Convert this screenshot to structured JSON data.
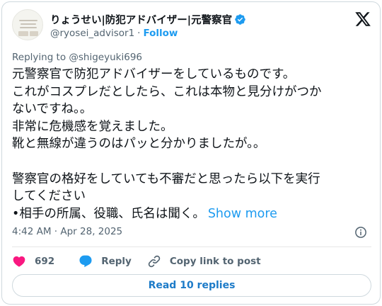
{
  "author": {
    "display_name": "りょうせい|防犯アドバイザー|元警察官",
    "handle": "@ryosei_advisor1",
    "separator": "·",
    "follow_label": "Follow"
  },
  "tweet": {
    "replying_to": "Replying to @shigeyuki696",
    "lines": [
      "元警察官で防犯アドバイザーをしているものです。",
      "これがコスプレだとしたら、これは本物と見分けがつか",
      "ないですね。。",
      "非常に危機感を覚えました。",
      "靴と無線が違うのはパッと分かりましたが。。",
      "",
      "警察官の格好をしていても不審だと思ったら以下を実行",
      "してください",
      "•相手の所属、役職、氏名は聞く。"
    ],
    "show_more_label": "Show more",
    "timestamp": "4:42 AM · Apr 28, 2025"
  },
  "actions": {
    "like_count": "692",
    "reply_label": "Reply",
    "copy_link_label": "Copy link to post"
  },
  "read_replies_label": "Read 10 replies",
  "colors": {
    "accent": "#1d9bf0",
    "like": "#f91880",
    "text": "#0f1419",
    "muted": "#536471"
  },
  "icons": [
    "avatar",
    "verified-badge-icon",
    "x-logo-icon",
    "info-icon",
    "heart-icon",
    "reply-bubble-icon",
    "link-icon"
  ]
}
